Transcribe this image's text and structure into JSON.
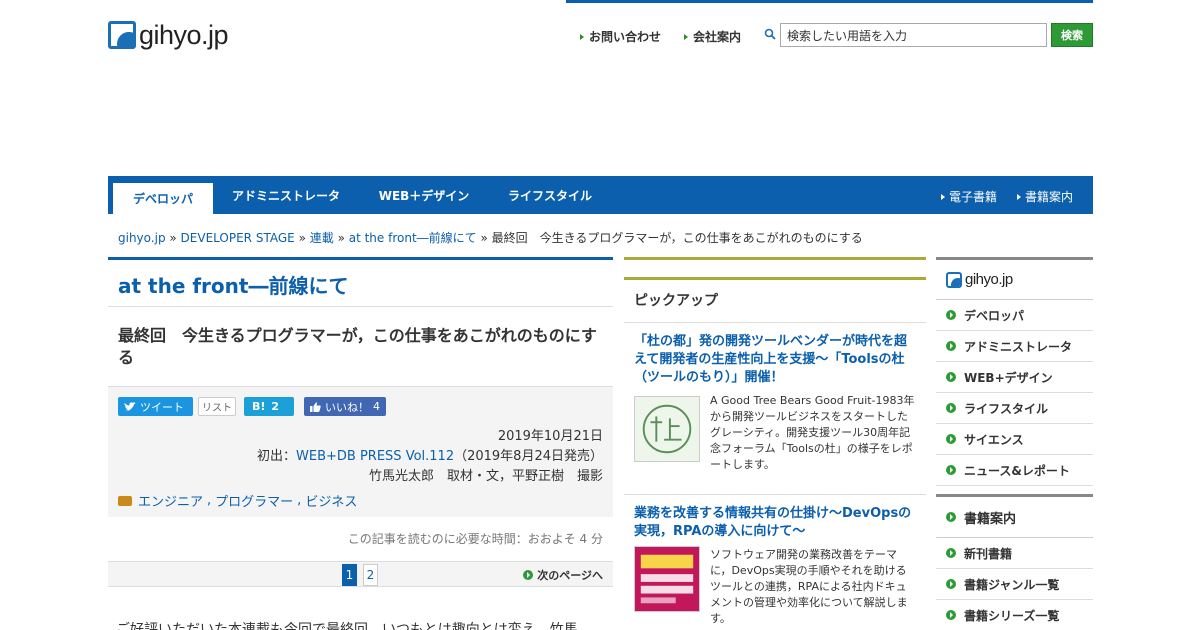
{
  "header": {
    "logo_text": "gihyo.jp",
    "links": [
      "お問い合わせ",
      "会社案内"
    ],
    "search_placeholder": "検索したい用語を入力",
    "search_button": "検索"
  },
  "nav": {
    "tabs": [
      "デベロッパ",
      "アドミニストレータ",
      "WEB＋デザイン",
      "ライフスタイル"
    ],
    "right_links": [
      "電子書籍",
      "書籍案内"
    ]
  },
  "breadcrumb": {
    "items": [
      "gihyo.jp",
      "DEVELOPER STAGE",
      "連載",
      "at the front―前線にて"
    ],
    "current": "最終回　今生きるプログラマーが，この仕事をあこがれのものにする"
  },
  "article": {
    "series_title": "at the front―前線にて",
    "title": "最終回　今生きるプログラマーが，この仕事をあこがれのものにする",
    "share": {
      "tweet": "ツイート",
      "list": "リスト",
      "hatena_label": "B!",
      "hatena_count": "2",
      "like_label": "いいね！",
      "like_count": "4"
    },
    "date": "2019年10月21日",
    "first_pub_prefix": "初出：",
    "first_pub_link": "WEB+DB PRESS Vol.112",
    "first_pub_suffix": "（2019年8月24日発売）",
    "credits": "竹馬光太郎　取材・文，平野正樹　撮影",
    "tags": [
      "エンジニア",
      "プログラマー",
      "ビジネス"
    ],
    "read_time": "この記事を読むのに必要な時間：おおよそ 4 分",
    "pages": [
      "1",
      "2"
    ],
    "next_page": "次のページへ",
    "body_start": "ご好評いただいた本連載も今回で最終回。いつもとは趣向とは変え，竹馬"
  },
  "pickup": {
    "heading": "ピックアップ",
    "items": [
      {
        "title": "「杜の都」発の開発ツールベンダーが時代を超えて開発者の生産性向上を支援～「Toolsの杜（ツールのもり）」開催！",
        "desc": "A Good Tree Bears Good Fruit-1983年から開発ツールビジネスをスタートしたグレーシティ。開発支援ツール30周年記念フォーラム「Toolsの杜」の様子をレポートします。"
      },
      {
        "title": "業務を改善する情報共有の仕掛け～DevOpsの実現，RPAの導入に向けて～",
        "desc": "ソフトウェア開発の業務改善をテーマに，DevOps実現の手順やそれを助けるツールとの連携，RPAによる社内ドキュメントの管理や効率化について解説します。"
      }
    ]
  },
  "sidebar": {
    "logo_text": "gihyo.jp",
    "items": [
      "デベロッパ",
      "アドミニストレータ",
      "WEB+デザイン",
      "ライフスタイル",
      "サイエンス",
      "ニュース&レポート"
    ],
    "books_heading": "書籍案内",
    "book_items": [
      "新刊書籍",
      "書籍ジャンル一覧",
      "書籍シリーズ一覧"
    ]
  },
  "colors": {
    "brand_blue": "#0b5fad",
    "accent_green": "#2e9a36",
    "pickup_olive": "#a9a93a"
  }
}
